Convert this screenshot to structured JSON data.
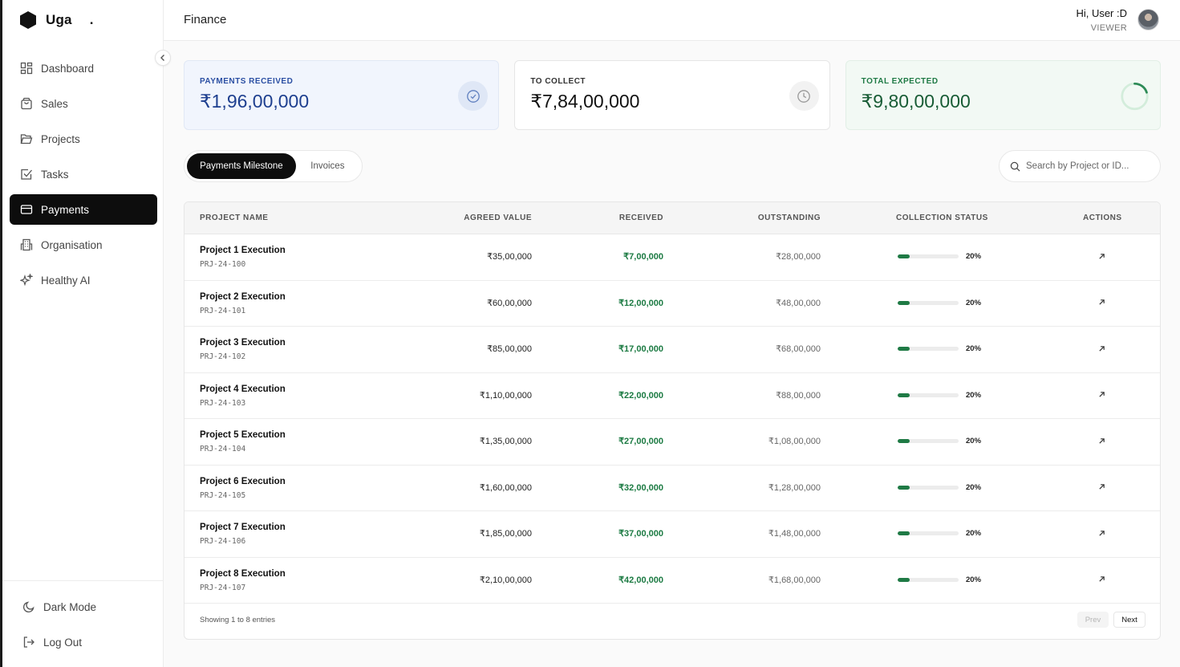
{
  "brand": {
    "name": "Uga",
    "dot": "."
  },
  "nav": [
    {
      "label": "Dashboard",
      "icon": "dashboard-icon"
    },
    {
      "label": "Sales",
      "icon": "shopping-bag-icon"
    },
    {
      "label": "Projects",
      "icon": "folder-icon"
    },
    {
      "label": "Tasks",
      "icon": "checkbox-icon"
    },
    {
      "label": "Payments",
      "icon": "credit-card-icon",
      "active": true
    },
    {
      "label": "Organisation",
      "icon": "building-icon"
    },
    {
      "label": "Healthy AI",
      "icon": "sparkles-icon"
    }
  ],
  "bottom_nav": {
    "dark_mode": "Dark Mode",
    "log_out": "Log Out"
  },
  "header": {
    "title": "Finance",
    "greeting": "Hi, User :D",
    "role": "VIEWER"
  },
  "cards": {
    "received": {
      "label": "PAYMENTS RECEIVED",
      "value": "₹1,96,00,000",
      "icon": "check-circle-icon"
    },
    "collect": {
      "label": "TO COLLECT",
      "value": "₹7,84,00,000",
      "icon": "clock-icon"
    },
    "expected": {
      "label": "TOTAL EXPECTED",
      "value": "₹9,80,00,000",
      "icon": "progress-ring-icon",
      "progress": 0.2
    }
  },
  "tabs": {
    "active": "Payments Milestone",
    "inactive": "Invoices"
  },
  "search": {
    "placeholder": "Search by Project or ID..."
  },
  "table": {
    "headers": {
      "project": "PROJECT NAME",
      "agreed": "AGREED VALUE",
      "received": "RECEIVED",
      "outstanding": "OUTSTANDING",
      "status": "COLLECTION STATUS",
      "actions": "ACTIONS"
    },
    "rows": [
      {
        "name": "Project 1 Execution",
        "id": "PRJ-24-100",
        "agreed": "₹35,00,000",
        "received": "₹7,00,000",
        "outstanding": "₹28,00,000",
        "pct": "20%",
        "progress": 0.2
      },
      {
        "name": "Project 2 Execution",
        "id": "PRJ-24-101",
        "agreed": "₹60,00,000",
        "received": "₹12,00,000",
        "outstanding": "₹48,00,000",
        "pct": "20%",
        "progress": 0.2
      },
      {
        "name": "Project 3 Execution",
        "id": "PRJ-24-102",
        "agreed": "₹85,00,000",
        "received": "₹17,00,000",
        "outstanding": "₹68,00,000",
        "pct": "20%",
        "progress": 0.2
      },
      {
        "name": "Project 4 Execution",
        "id": "PRJ-24-103",
        "agreed": "₹1,10,00,000",
        "received": "₹22,00,000",
        "outstanding": "₹88,00,000",
        "pct": "20%",
        "progress": 0.2
      },
      {
        "name": "Project 5 Execution",
        "id": "PRJ-24-104",
        "agreed": "₹1,35,00,000",
        "received": "₹27,00,000",
        "outstanding": "₹1,08,00,000",
        "pct": "20%",
        "progress": 0.2
      },
      {
        "name": "Project 6 Execution",
        "id": "PRJ-24-105",
        "agreed": "₹1,60,00,000",
        "received": "₹32,00,000",
        "outstanding": "₹1,28,00,000",
        "pct": "20%",
        "progress": 0.2
      },
      {
        "name": "Project 7 Execution",
        "id": "PRJ-24-106",
        "agreed": "₹1,85,00,000",
        "received": "₹37,00,000",
        "outstanding": "₹1,48,00,000",
        "pct": "20%",
        "progress": 0.2
      },
      {
        "name": "Project 8 Execution",
        "id": "PRJ-24-107",
        "agreed": "₹2,10,00,000",
        "received": "₹42,00,000",
        "outstanding": "₹1,68,00,000",
        "pct": "20%",
        "progress": 0.2
      }
    ],
    "footer": {
      "entries": "Showing 1 to 8 entries",
      "prev": "Prev",
      "next": "Next"
    }
  },
  "colors": {
    "accent": "#0d0d0d",
    "success": "#1f7a45",
    "info": "#2b4fa3"
  }
}
